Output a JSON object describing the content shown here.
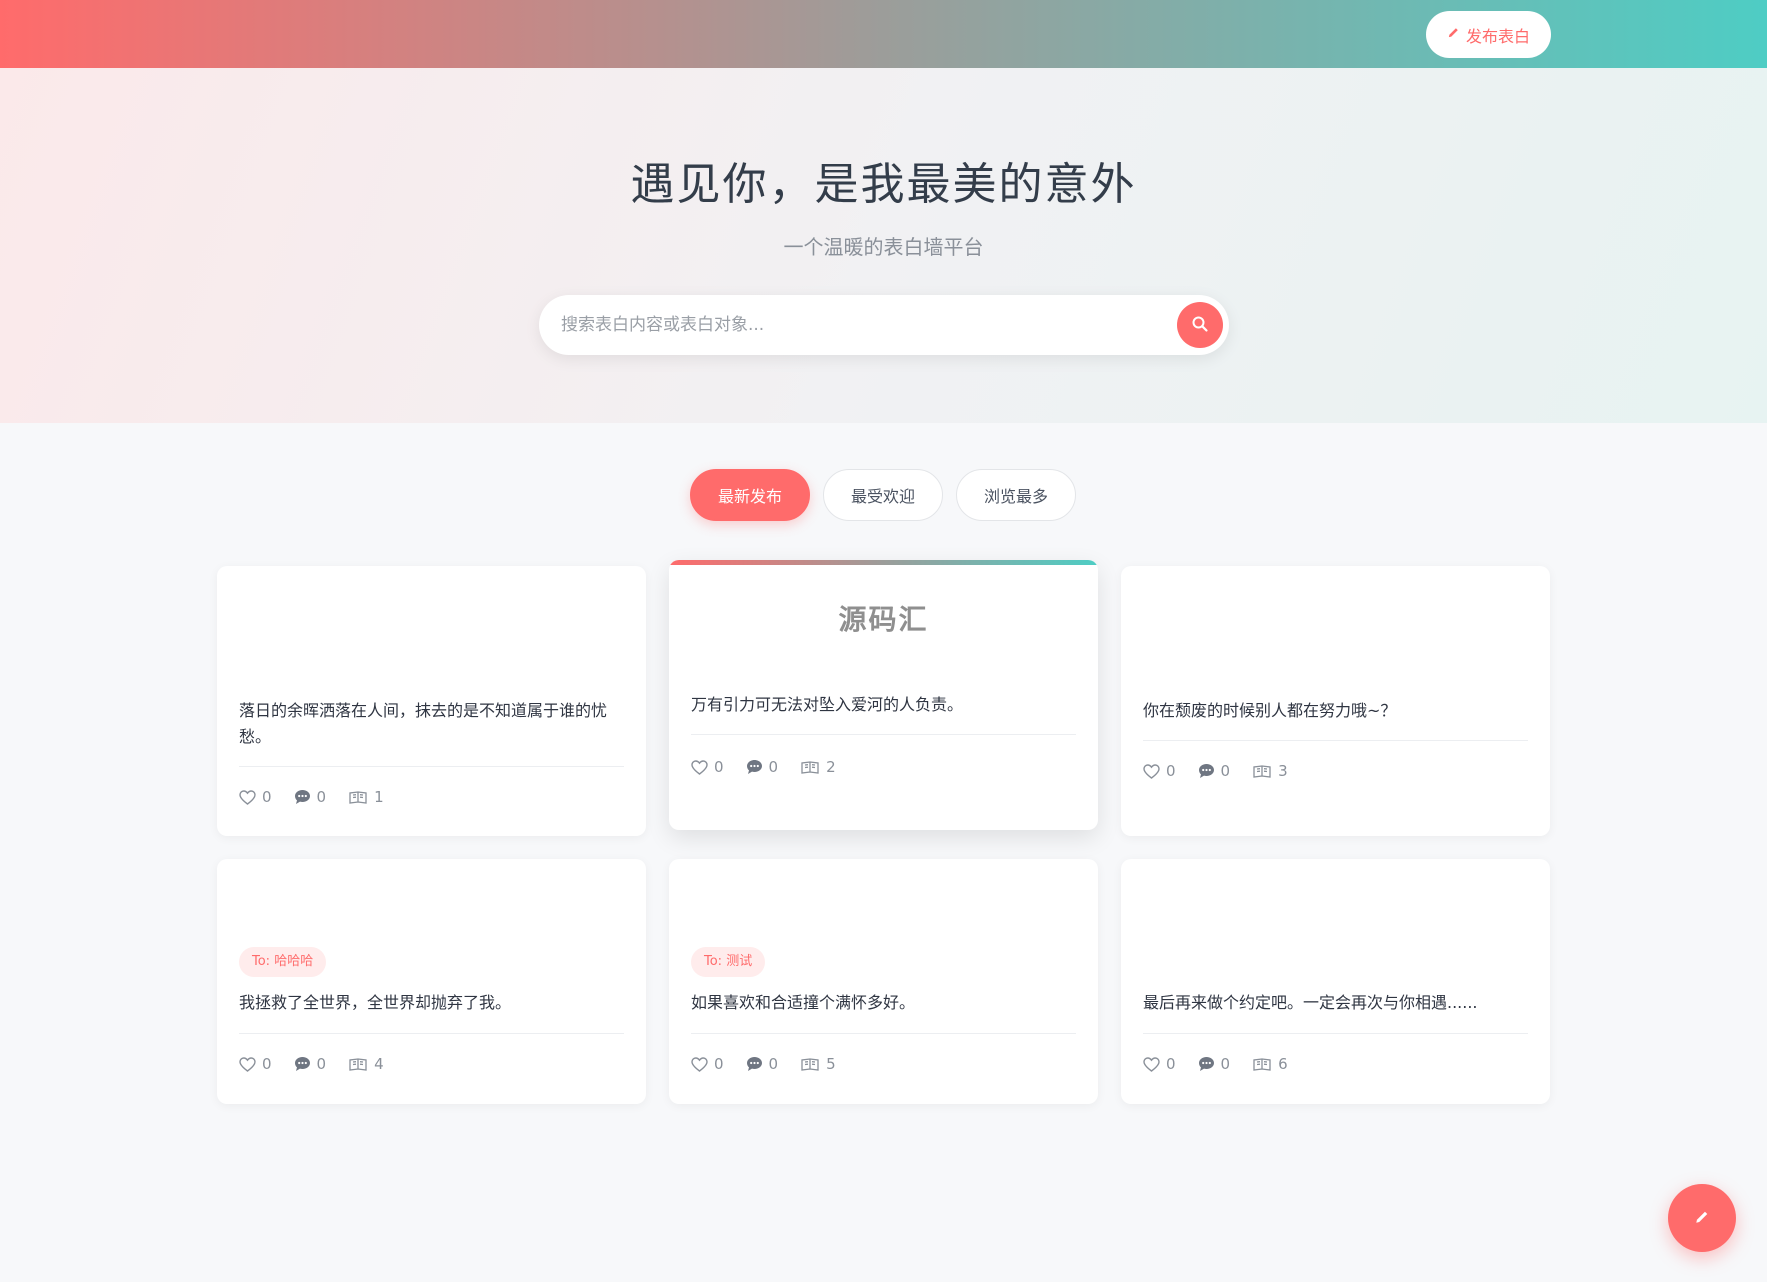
{
  "header": {
    "publish_label": "发布表白"
  },
  "hero": {
    "title": "遇见你，是我最美的意外",
    "subtitle": "一个温暖的表白墙平台",
    "search_placeholder": "搜索表白内容或表白对象..."
  },
  "tabs": [
    {
      "label": "最新发布",
      "active": true
    },
    {
      "label": "最受欢迎",
      "active": false
    },
    {
      "label": "浏览最多",
      "active": false
    }
  ],
  "cards": [
    {
      "to": "",
      "text": "落日的余晖洒落在人间，抹去的是不知道属于谁的忧愁。",
      "likes": "0",
      "comments": "0",
      "views": "1"
    },
    {
      "to": "",
      "watermark": "源码汇",
      "text": "万有引力可无法对坠入爱河的人负责。",
      "likes": "0",
      "comments": "0",
      "views": "2"
    },
    {
      "to": "",
      "text": "你在颓废的时候别人都在努力哦~？",
      "likes": "0",
      "comments": "0",
      "views": "3"
    },
    {
      "to": "To: 哈哈哈",
      "text": "我拯救了全世界，全世界却抛弃了我。",
      "likes": "0",
      "comments": "0",
      "views": "4"
    },
    {
      "to": "To: 测试",
      "text": "如果喜欢和合适撞个满怀多好。",
      "likes": "0",
      "comments": "0",
      "views": "5"
    },
    {
      "to": "",
      "text": "最后再来做个约定吧。一定会再次与你相遇......",
      "likes": "0",
      "comments": "0",
      "views": "6"
    }
  ],
  "icons": {
    "publish": "pencil-icon",
    "search": "search-icon",
    "like": "heart-icon",
    "comment": "comment-icon",
    "view": "book-icon",
    "fab": "pencil-icon"
  },
  "colors": {
    "accent": "#ff6b6b",
    "teal": "#4ecdc4"
  }
}
